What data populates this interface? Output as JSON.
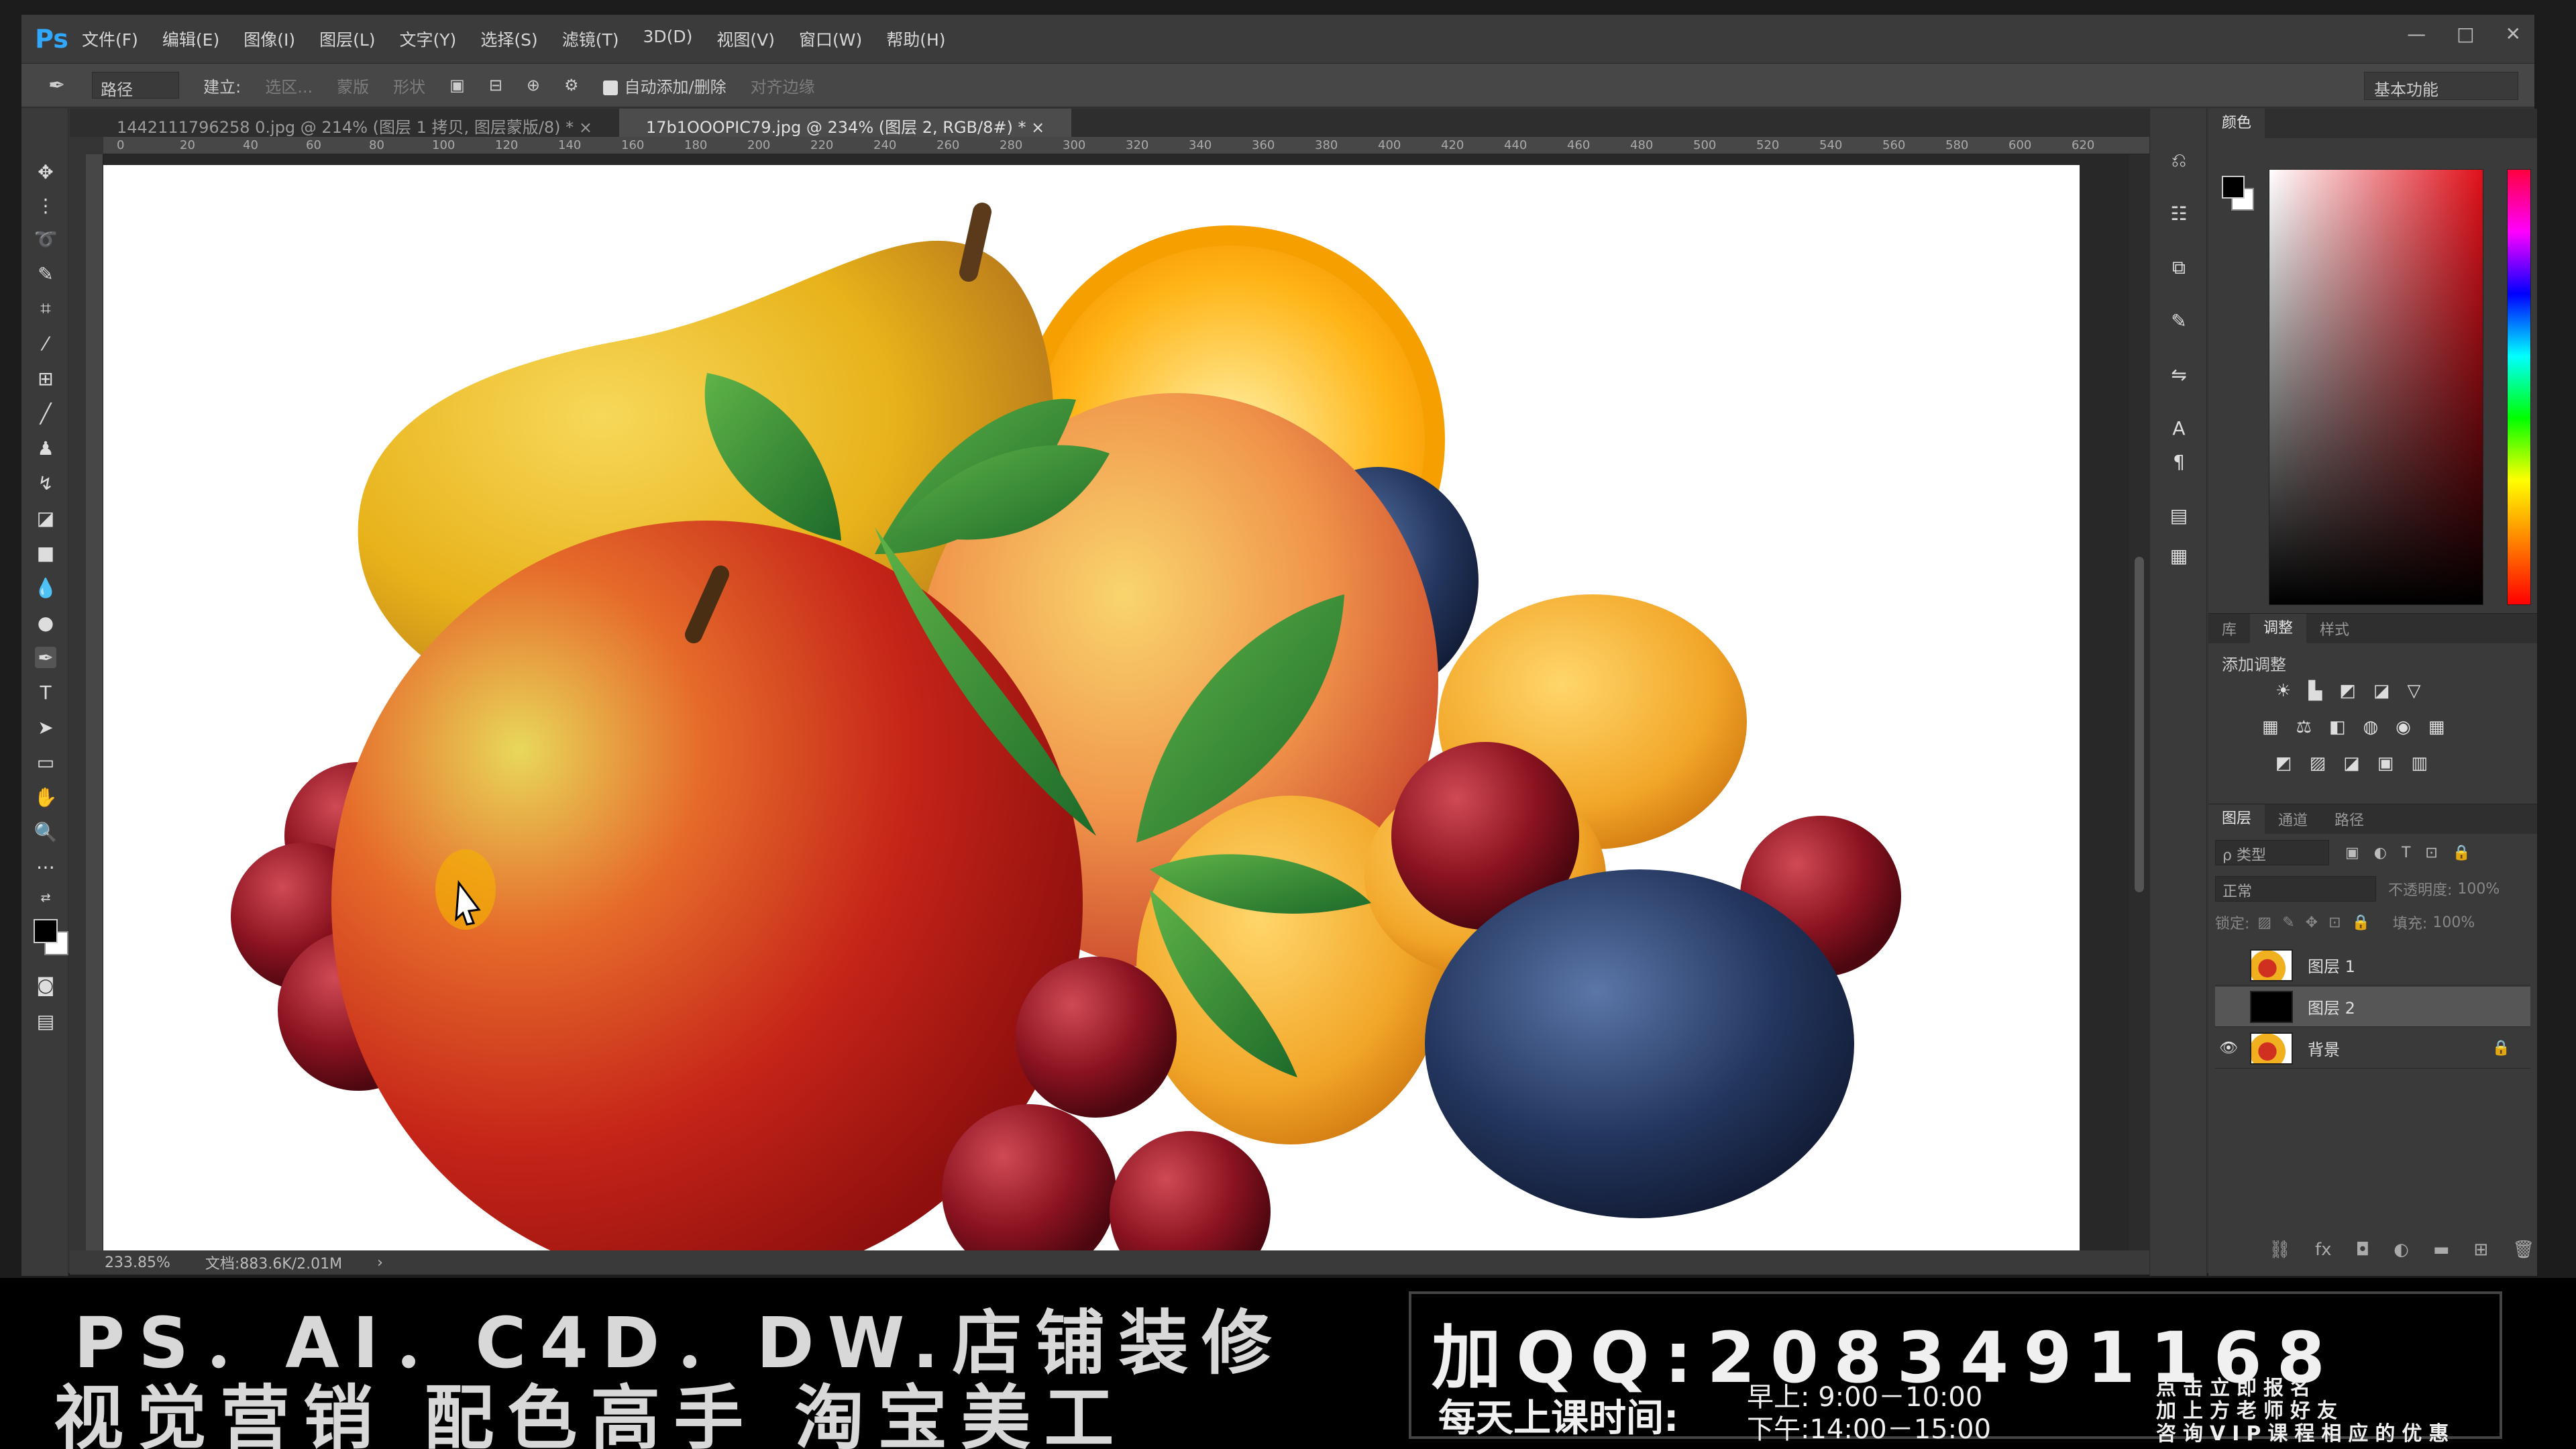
{
  "app": {
    "logo": "Ps",
    "menu": [
      "文件(F)",
      "编辑(E)",
      "图像(I)",
      "图层(L)",
      "文字(Y)",
      "选择(S)",
      "滤镜(T)",
      "3D(D)",
      "视图(V)",
      "窗口(W)",
      "帮助(H)"
    ],
    "window_buttons": [
      "—",
      "□",
      "✕"
    ]
  },
  "options": {
    "mode_select": "路径",
    "build_label": "建立:",
    "selection_btn": "选区...",
    "mask_btn": "蒙版",
    "shape_btn": "形状",
    "auto_add_delete": "自动添加/删除",
    "align_edges": "对齐边缘",
    "workspace": "基本功能"
  },
  "tabs": [
    {
      "label": "1442111796258 0.jpg @ 214% (图层 1 拷贝, 图层蒙版/8) *",
      "close": "×"
    },
    {
      "label": "17b1OOOPIC79.jpg @ 234% (图层 2, RGB/8#) *",
      "close": "×"
    }
  ],
  "ruler": [
    "0",
    "20",
    "40",
    "60",
    "80",
    "100",
    "120",
    "140",
    "160",
    "180",
    "200",
    "220",
    "240",
    "260",
    "280",
    "300",
    "320",
    "340",
    "360",
    "380",
    "400",
    "420",
    "440",
    "460",
    "480",
    "500",
    "520",
    "540",
    "560",
    "580",
    "600",
    "620"
  ],
  "status": {
    "zoom": "233.85%",
    "doc": "文档:883.6K/2.01M"
  },
  "color_panel": {
    "tab": "颜色",
    "fg_color": "#000000",
    "bg_color": "#ffffff"
  },
  "adjust_panel": {
    "tabs": [
      "库",
      "调整",
      "样式"
    ],
    "title": "添加调整"
  },
  "layers_panel": {
    "tabs": [
      "图层",
      "通道",
      "路径"
    ],
    "filter": "ρ 类型",
    "blend": "正常",
    "opacity_label": "不透明度:",
    "opacity": "100%",
    "lock_label": "锁定:",
    "fill_label": "填充:",
    "fill": "100%",
    "layers": [
      {
        "name": "图层 1",
        "visible": false,
        "thumb": "fruit"
      },
      {
        "name": "图层 2",
        "visible": false,
        "thumb": "black",
        "selected": true
      },
      {
        "name": "背景",
        "visible": true,
        "thumb": "fruit",
        "locked": true
      }
    ]
  },
  "banner": {
    "line1": "PS．AI．C4D．DW.店铺装修",
    "line2": "视觉营销  配色高手  淘宝美工",
    "qq": "加QQ:2083491168",
    "class_time_label": "每天上课时间:",
    "morning": "早上: 9:00－10:00",
    "afternoon": "下午:14:00－15:00",
    "promo1": "点击立即报名",
    "promo2": "加上方老师好友",
    "promo3": "咨询VIP课程相应的优惠"
  }
}
